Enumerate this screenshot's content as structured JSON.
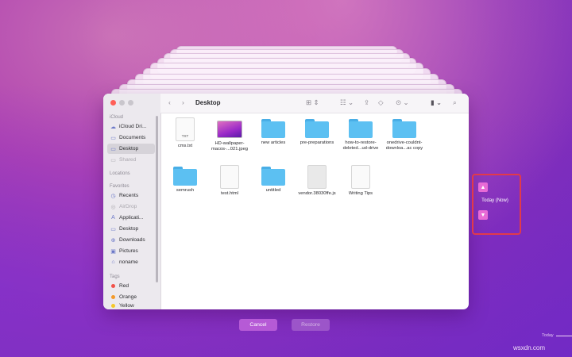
{
  "window": {
    "title": "Desktop",
    "sidebar": {
      "sections": {
        "icloud": "iCloud",
        "locations": "Locations",
        "favorites": "Favorites",
        "tags": "Tags"
      },
      "icloud_items": [
        {
          "label": "iCloud Dri...",
          "icon": "cloud-icon"
        },
        {
          "label": "Documents",
          "icon": "document-icon"
        },
        {
          "label": "Desktop",
          "icon": "desktop-icon"
        },
        {
          "label": "Shared",
          "icon": "shared-folder-icon"
        }
      ],
      "favorite_items": [
        {
          "label": "Recents",
          "icon": "clock-icon"
        },
        {
          "label": "AirDrop",
          "icon": "airdrop-icon"
        },
        {
          "label": "Applicati...",
          "icon": "applications-icon"
        },
        {
          "label": "Desktop",
          "icon": "desktop-icon"
        },
        {
          "label": "Downloads",
          "icon": "downloads-icon"
        },
        {
          "label": "Pictures",
          "icon": "pictures-icon"
        },
        {
          "label": "noname",
          "icon": "home-icon"
        }
      ],
      "tag_items": [
        {
          "label": "Red",
          "color": "#f2524a"
        },
        {
          "label": "Orange",
          "color": "#f39a2b"
        },
        {
          "label": "Yellow",
          "color": "#f5c829"
        }
      ]
    },
    "files": [
      {
        "label": "cms.txt",
        "type": "doc",
        "ext": "TXT"
      },
      {
        "label": "HD-wallpaper-macos-...021.jpeg",
        "type": "image"
      },
      {
        "label": "new articles",
        "type": "folder"
      },
      {
        "label": "pre-preparations",
        "type": "folder"
      },
      {
        "label": "how-to-restore-deleted...ud-drive",
        "type": "folder"
      },
      {
        "label": "onedrive-couldnt-downloa...ac copy",
        "type": "folder"
      },
      {
        "label": "semrush",
        "type": "folder"
      },
      {
        "label": "test.html",
        "type": "doc",
        "ext": ""
      },
      {
        "label": "untitled",
        "type": "folder"
      },
      {
        "label": "vendor.38030ffe.js",
        "type": "doc-gray",
        "ext": ""
      },
      {
        "label": "Writing Tips",
        "type": "doc",
        "ext": ""
      }
    ]
  },
  "buttons": {
    "cancel": "Cancel",
    "restore": "Restore"
  },
  "timemachine": {
    "current": "Today (Now)",
    "timeline_label": "Today"
  },
  "watermark": "wsxdn.com",
  "colors": {
    "accent": "#b65ad6",
    "highlight_box": "#e23a4a",
    "folder": "#5cc0f2"
  }
}
